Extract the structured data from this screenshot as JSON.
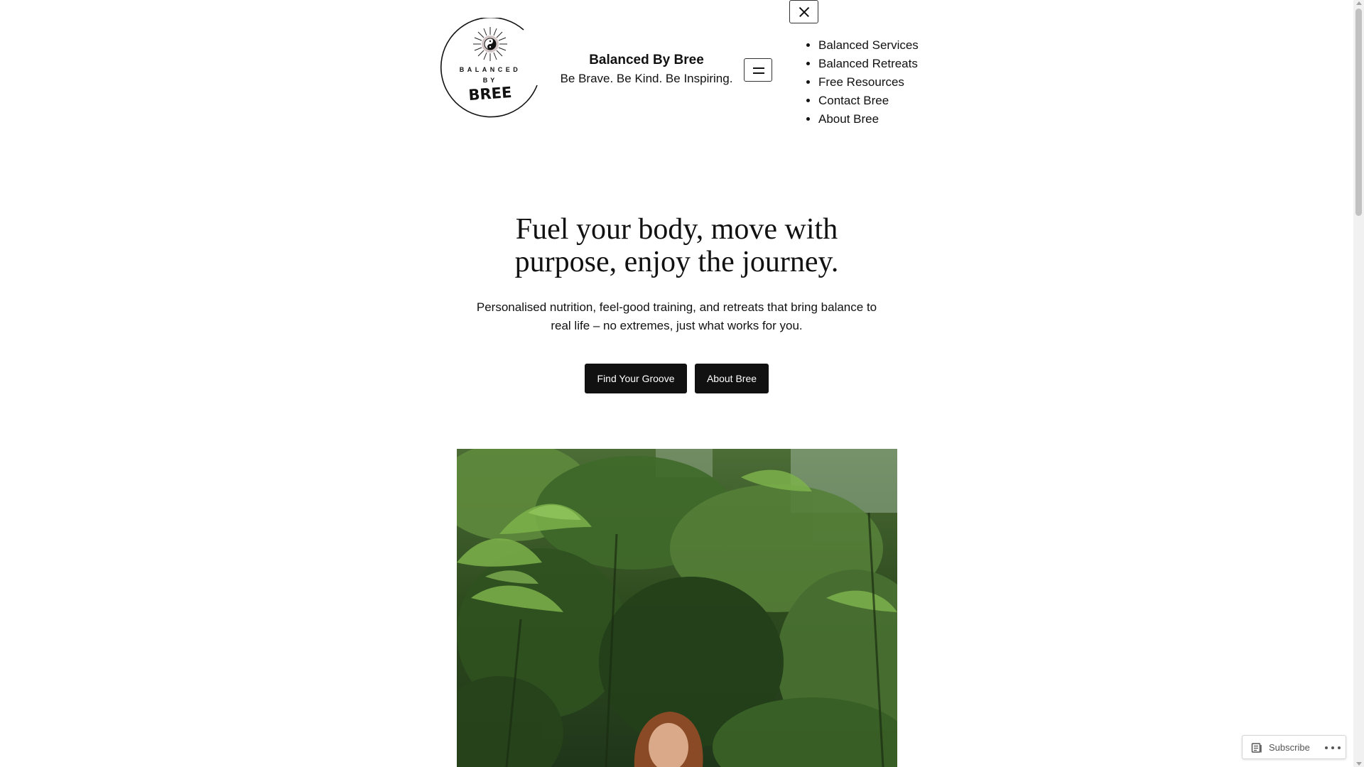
{
  "header": {
    "site_title": "Balanced By Bree",
    "tagline": "Be Brave. Be Kind. Be Inspiring.",
    "logo": {
      "line1": "BALANCED",
      "line2": "BY",
      "line3": "BREE"
    }
  },
  "nav": {
    "items": [
      {
        "label": "Balanced Services"
      },
      {
        "label": "Balanced Retreats"
      },
      {
        "label": "Free Resources"
      },
      {
        "label": "Contact Bree"
      },
      {
        "label": "About Bree"
      }
    ],
    "toggle_icon": "hamburger-menu-icon",
    "close_icon": "close-icon"
  },
  "hero": {
    "title": "Fuel your body, move with purpose, enjoy the journey.",
    "description": "Personalised nutrition, feel-good training, and retreats that bring balance to real life – no extremes, just what works for you.",
    "buttons": [
      {
        "label": "Find Your Groove"
      },
      {
        "label": "About Bree"
      }
    ]
  },
  "subscribe": {
    "label": "Subscribe",
    "icon": "reader-icon",
    "more_icon": "ellipsis-icon"
  },
  "colors": {
    "background": "#ffffff",
    "text": "#111111",
    "button_bg": "#111111",
    "button_text": "#ffffff"
  }
}
